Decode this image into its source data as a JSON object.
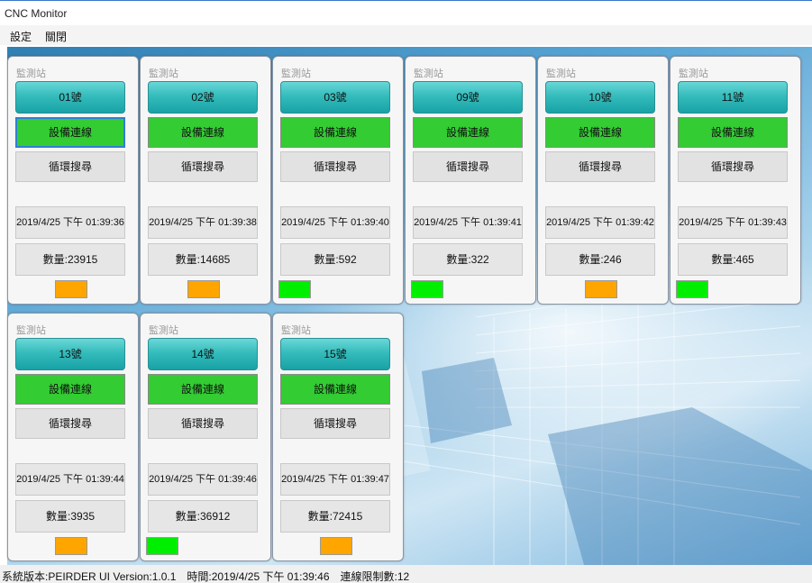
{
  "window": {
    "title": "CNC Monitor"
  },
  "menu": {
    "items": [
      "設定",
      "關閉"
    ]
  },
  "panel_title": "監測站",
  "colors": {
    "station": "#35bcbc",
    "connected": "#33cc33",
    "led_orange": "#ffa500",
    "led_green": "#00ee00"
  },
  "panels": [
    {
      "station": "01號",
      "connection": "設備連線",
      "mode": "循環搜尋",
      "time": "2019/4/25 下午 01:39:36",
      "count": "數量:23915",
      "led": "orange"
    },
    {
      "station": "02號",
      "connection": "設備連線",
      "mode": "循環搜尋",
      "time": "2019/4/25 下午 01:39:38",
      "count": "數量:14685",
      "led": "orange"
    },
    {
      "station": "03號",
      "connection": "設備連線",
      "mode": "循環搜尋",
      "time": "2019/4/25 下午 01:39:40",
      "count": "數量:592",
      "led": "green"
    },
    {
      "station": "09號",
      "connection": "設備連線",
      "mode": "循環搜尋",
      "time": "2019/4/25 下午 01:39:41",
      "count": "數量:322",
      "led": "green"
    },
    {
      "station": "10號",
      "connection": "設備連線",
      "mode": "循環搜尋",
      "time": "2019/4/25 下午 01:39:42",
      "count": "數量:246",
      "led": "orange"
    },
    {
      "station": "11號",
      "connection": "設備連線",
      "mode": "循環搜尋",
      "time": "2019/4/25 下午 01:39:43",
      "count": "數量:465",
      "led": "green"
    },
    {
      "station": "13號",
      "connection": "設備連線",
      "mode": "循環搜尋",
      "time": "2019/4/25 下午 01:39:44",
      "count": "數量:3935",
      "led": "orange"
    },
    {
      "station": "14號",
      "connection": "設備連線",
      "mode": "循環搜尋",
      "time": "2019/4/25 下午 01:39:46",
      "count": "數量:36912",
      "led": "green"
    },
    {
      "station": "15號",
      "connection": "設備連線",
      "mode": "循環搜尋",
      "time": "2019/4/25 下午 01:39:47",
      "count": "數量:72415",
      "led": "orange"
    }
  ],
  "status": {
    "text": "系統版本:PEIRDER UI Version:1.0.1　時間:2019/4/25 下午 01:39:46　連線限制數:12"
  }
}
